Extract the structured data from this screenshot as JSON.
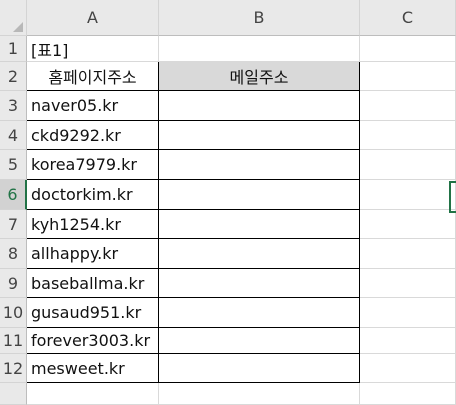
{
  "columns": [
    "A",
    "B",
    "C"
  ],
  "rows": [
    "1",
    "2",
    "3",
    "4",
    "5",
    "6",
    "7",
    "8",
    "9",
    "10",
    "11",
    "12",
    ""
  ],
  "active_row": "6",
  "cells": {
    "A1": "[표1]",
    "A2": "홈페이지주소",
    "B2": "메일주소",
    "A3": "naver05.kr",
    "A4": "ckd9292.kr",
    "A5": "korea7979.kr",
    "A6": "doctorkim.kr",
    "A7": "kyh1254.kr",
    "A8": "allhappy.kr",
    "A9": "baseballma.kr",
    "A10": "gusaud951.kr",
    "A11": "forever3003.kr",
    "A12": "mesweet.kr"
  },
  "colors": {
    "accent": "#217346",
    "header_fill": "#d9d9d9"
  }
}
